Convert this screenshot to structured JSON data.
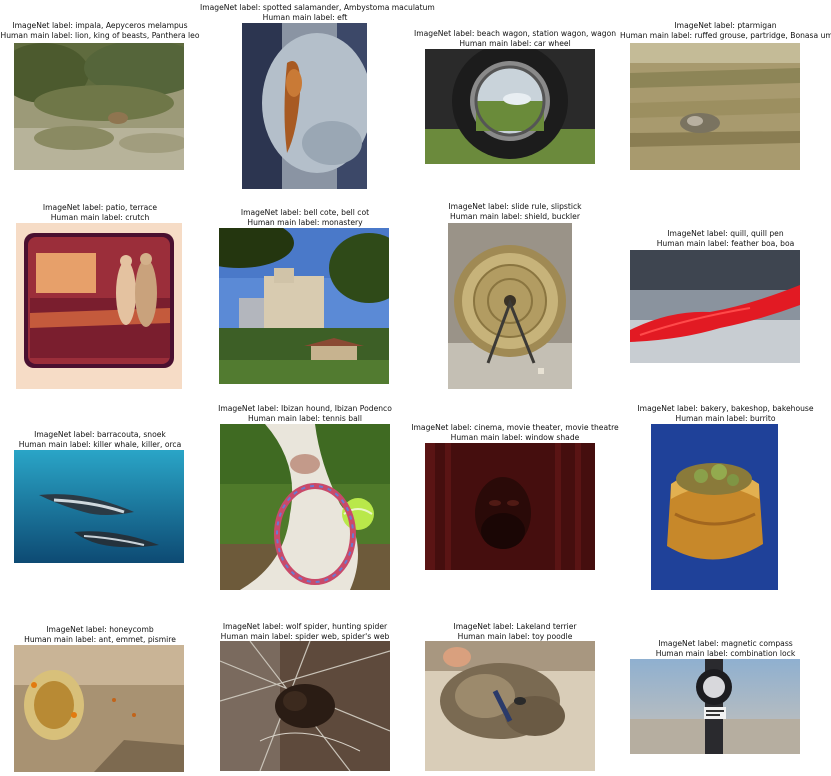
{
  "label_prefixes": {
    "imagenet": "ImageNet label: ",
    "human": "Human main label: "
  },
  "cells": [
    {
      "imagenet": "impala, Aepyceros melampus",
      "human": "lion, king of beasts, Panthera leo",
      "scene": "savanna-antelope"
    },
    {
      "imagenet": "spotted salamander, Ambystoma maculatum",
      "human": "eft",
      "scene": "hand-holding-newt"
    },
    {
      "imagenet": "beach wagon, station wagon, wagon",
      "human": "car wheel",
      "scene": "chrome-hubcap-reflection"
    },
    {
      "imagenet": "ptarmigan",
      "human": "ruffed grouse, partridge, Bonasa umbellus",
      "scene": "bird-in-dry-grass"
    },
    {
      "imagenet": "patio, terrace",
      "human": "crutch",
      "scene": "vintage-couple-walking-toward-building"
    },
    {
      "imagenet": "bell cote, bell cot",
      "human": "monastery",
      "scene": "park-with-buildings-and-gazebo"
    },
    {
      "imagenet": "slide rule, slipstick",
      "human": "shield, buckler",
      "scene": "circular-metal-shield-on-stand"
    },
    {
      "imagenet": "quill, quill pen",
      "human": "feather boa, boa",
      "scene": "red-feather-closeup"
    },
    {
      "imagenet": "barracouta, snoek",
      "human": "killer whale, killer, orca",
      "scene": "dolphins-underwater"
    },
    {
      "imagenet": "Ibizan hound, Ibizan Podenco",
      "human": "tennis ball",
      "scene": "dog-with-rope-toy-and-ball"
    },
    {
      "imagenet": "cinema, movie theater, movie theatre",
      "human": "window shade",
      "scene": "man-in-dark-red-room"
    },
    {
      "imagenet": "bakery, bakeshop, bakehouse",
      "human": "burrito",
      "scene": "pastry-on-blue-background"
    },
    {
      "imagenet": "honeycomb",
      "human": "ant, emmet, pismire",
      "scene": "ants-on-honeycomb"
    },
    {
      "imagenet": "wolf spider, hunting spider",
      "human": "spider web, spider's web",
      "scene": "spider-in-web"
    },
    {
      "imagenet": "Lakeland terrier",
      "human": "toy poodle",
      "scene": "fluffy-dog-lying-down"
    },
    {
      "imagenet": "magnetic compass",
      "human": "combination lock",
      "scene": "compass-against-sky"
    }
  ]
}
